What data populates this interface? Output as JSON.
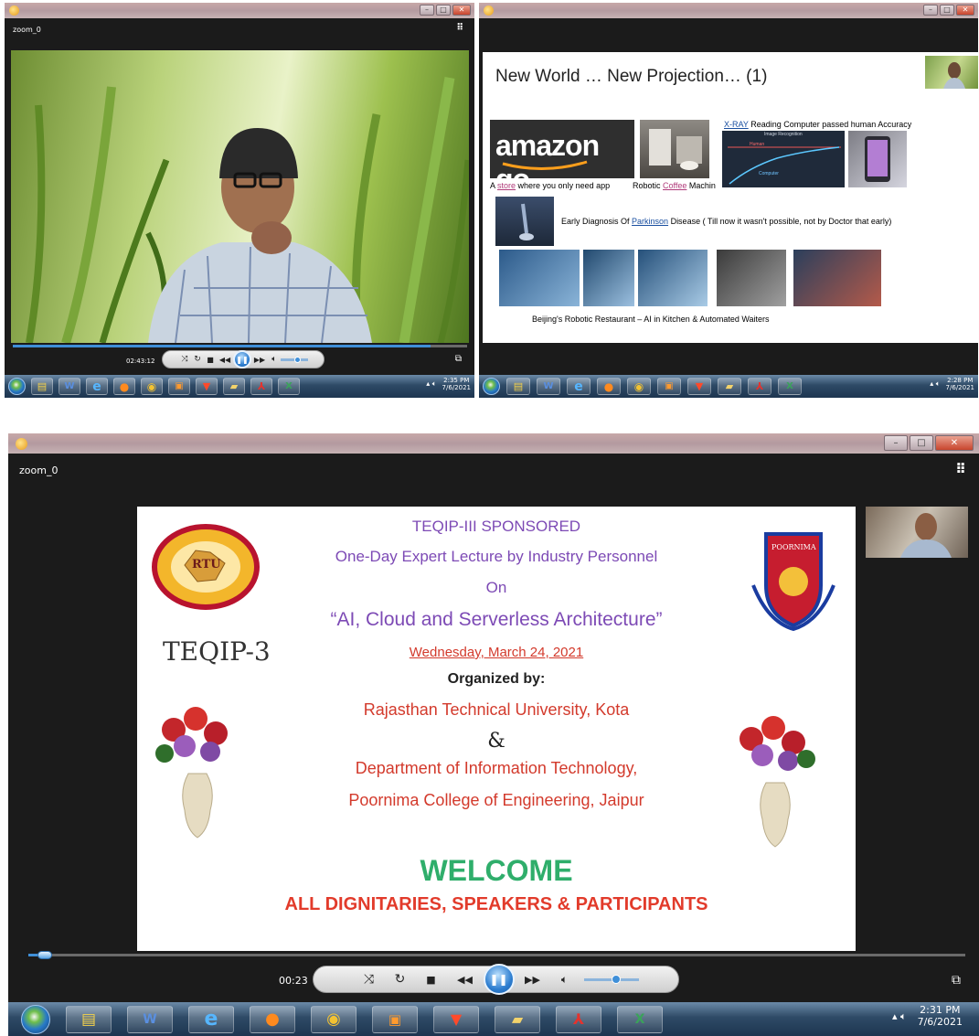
{
  "window1": {
    "zoom_label": "zoom_0",
    "elapsed": "02:43:12",
    "progress": 0.92,
    "volume": 0.5,
    "taskbar": {
      "clock_time": "2:35 PM",
      "clock_date": "7/6/2021",
      "apps": [
        "explorer",
        "word",
        "internet-explorer",
        "firefox",
        "chrome",
        "media-player",
        "brave",
        "folder",
        "pdf-reader",
        "excel"
      ]
    }
  },
  "window2": {
    "slide": {
      "title": "New World … New Projection… (1)",
      "amazon_logo": "amazon go",
      "caption_store_prefix": "A ",
      "caption_store_link": "store",
      "caption_store_suffix": " where you only need app",
      "caption_coffee_prefix": "Robotic ",
      "caption_coffee_link": "Coffee",
      "caption_coffee_suffix": " Machin",
      "caption_xray_link": "X-RAY",
      "caption_xray_suffix": " Reading Computer passed human Accuracy",
      "chart_title": "Image Recognition",
      "chart_human": "Human",
      "chart_computer": "Computer",
      "caption_parkinson_prefix": "Early Diagnosis  Of ",
      "caption_parkinson_link": "Parkinson",
      "caption_parkinson_suffix": "  Disease  ( Till now it wasn't possible, not by Doctor that early)",
      "caption_beijing": "Beijing's  Robotic Restaurant – AI in Kitchen  & Automated Waiters"
    },
    "taskbar": {
      "clock_time": "2:28 PM",
      "clock_date": "7/6/2021"
    }
  },
  "window3": {
    "zoom_label": "zoom_0",
    "elapsed": "00:23",
    "progress": 0.01,
    "volume": 0.5,
    "slide": {
      "line1": "TEQIP-III SPONSORED",
      "line2": "One-Day Expert Lecture by Industry Personnel",
      "line3": "On",
      "line4": "“AI, Cloud and Serverless Architecture”",
      "line5": "Wednesday, March 24, 2021",
      "line6": "Organized by:",
      "line7": "Rajasthan Technical University, Kota",
      "line8": "&",
      "line9": "Department of Information Technology,",
      "line10": "Poornima College of Engineering, Jaipur",
      "welcome": "WELCOME",
      "dignitaries": "ALL DIGNITARIES, SPEAKERS & PARTICIPANTS",
      "teqip_logo": "TEQIP-3",
      "rtu_logo": "RTU",
      "poornima_logo": "POORNIMA"
    },
    "taskbar": {
      "clock_time": "2:31 PM",
      "clock_date": "7/6/2021"
    }
  }
}
